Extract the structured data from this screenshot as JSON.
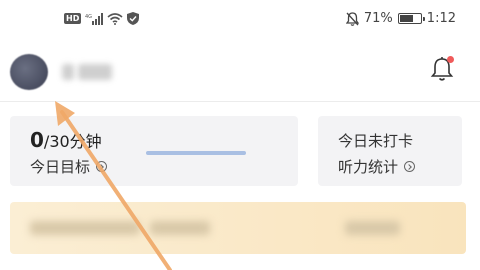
{
  "status_bar": {
    "hd_label": "HD",
    "signal_label": "4G",
    "battery_text": "71%",
    "battery_level": 0.71,
    "time": "1:12",
    "icons": [
      "signal-icon",
      "wifi-icon",
      "shield-icon",
      "mute-icon",
      "battery-icon"
    ]
  },
  "header": {
    "username": "",
    "notification_dot": true
  },
  "goal_card": {
    "current": "0",
    "target_suffix": "/30分钟",
    "label": "今日目标",
    "progress": 0.0
  },
  "listen_card": {
    "status": "今日未打卡",
    "label": "听力统计"
  },
  "colors": {
    "accent": "#2f6fd6",
    "card_bg": "#f3f3f5",
    "banner_bg": "#f9e4bd",
    "notification_dot": "#f05a5a",
    "annotation_arrow": "#f0a868"
  }
}
